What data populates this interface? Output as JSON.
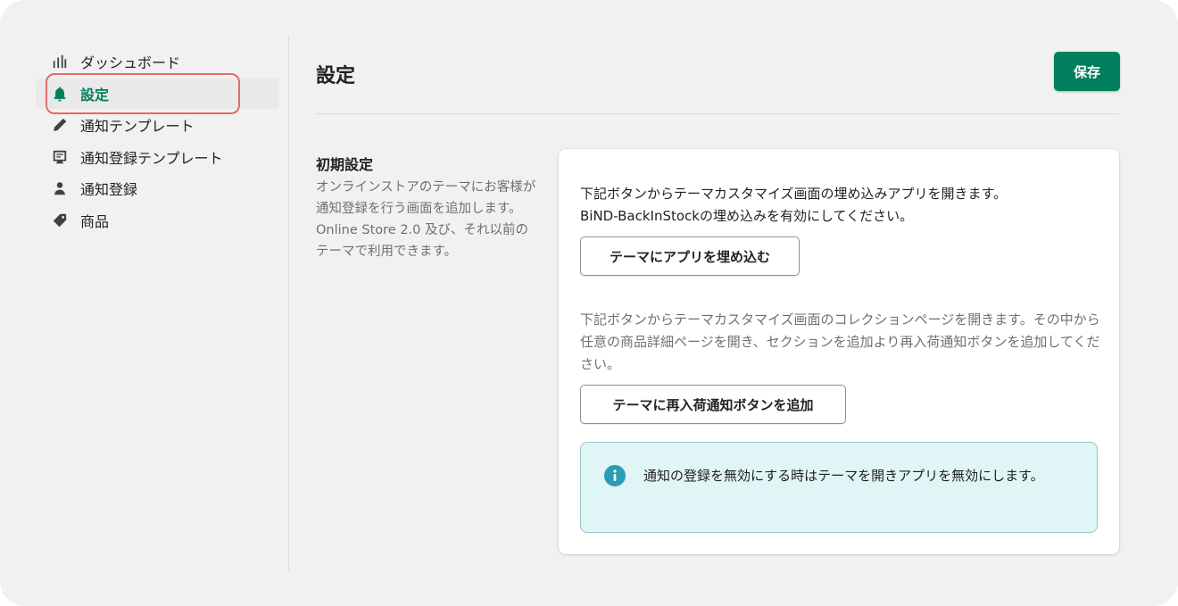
{
  "sidebar": {
    "items": [
      {
        "label": "ダッシュボード",
        "icon": "bar-chart-icon",
        "active": false
      },
      {
        "label": "設定",
        "icon": "bell-icon",
        "active": true
      },
      {
        "label": "通知テンプレート",
        "icon": "pencil-icon",
        "active": false
      },
      {
        "label": "通知登録テンプレート",
        "icon": "template-icon",
        "active": false
      },
      {
        "label": "通知登録",
        "icon": "person-icon",
        "active": false
      },
      {
        "label": "商品",
        "icon": "tag-icon",
        "active": false
      }
    ]
  },
  "header": {
    "title": "設定",
    "save_label": "保存"
  },
  "section": {
    "title": "初期設定",
    "description_1": "オンラインストアのテーマにお客様が通知登録を行う画面を追加します。",
    "description_2": "Online Store 2.0 及び、それ以前のテーマで利用できます。"
  },
  "card": {
    "text_1_line1": "下記ボタンからテーマカスタマイズ画面の埋め込みアプリを開きます。",
    "text_1_line2": "BiND-BackInStockの埋め込みを有効にしてください。",
    "button_1": "テーマにアプリを埋め込む",
    "text_2": "下記ボタンからテーマカスタマイズ画面のコレクションページを開きます。その中から任意の商品詳細ページを開き、セクションを追加より再入荷通知ボタンを追加してください。",
    "button_2": "テーマに再入荷通知ボタンを追加",
    "info": "通知の登録を無効にする時はテーマを開きアプリを無効にします。"
  },
  "colors": {
    "primary": "#007f5f",
    "highlight": "#e06b67",
    "info_bg": "#e0f5f5",
    "info_icon": "#2a9db5"
  }
}
